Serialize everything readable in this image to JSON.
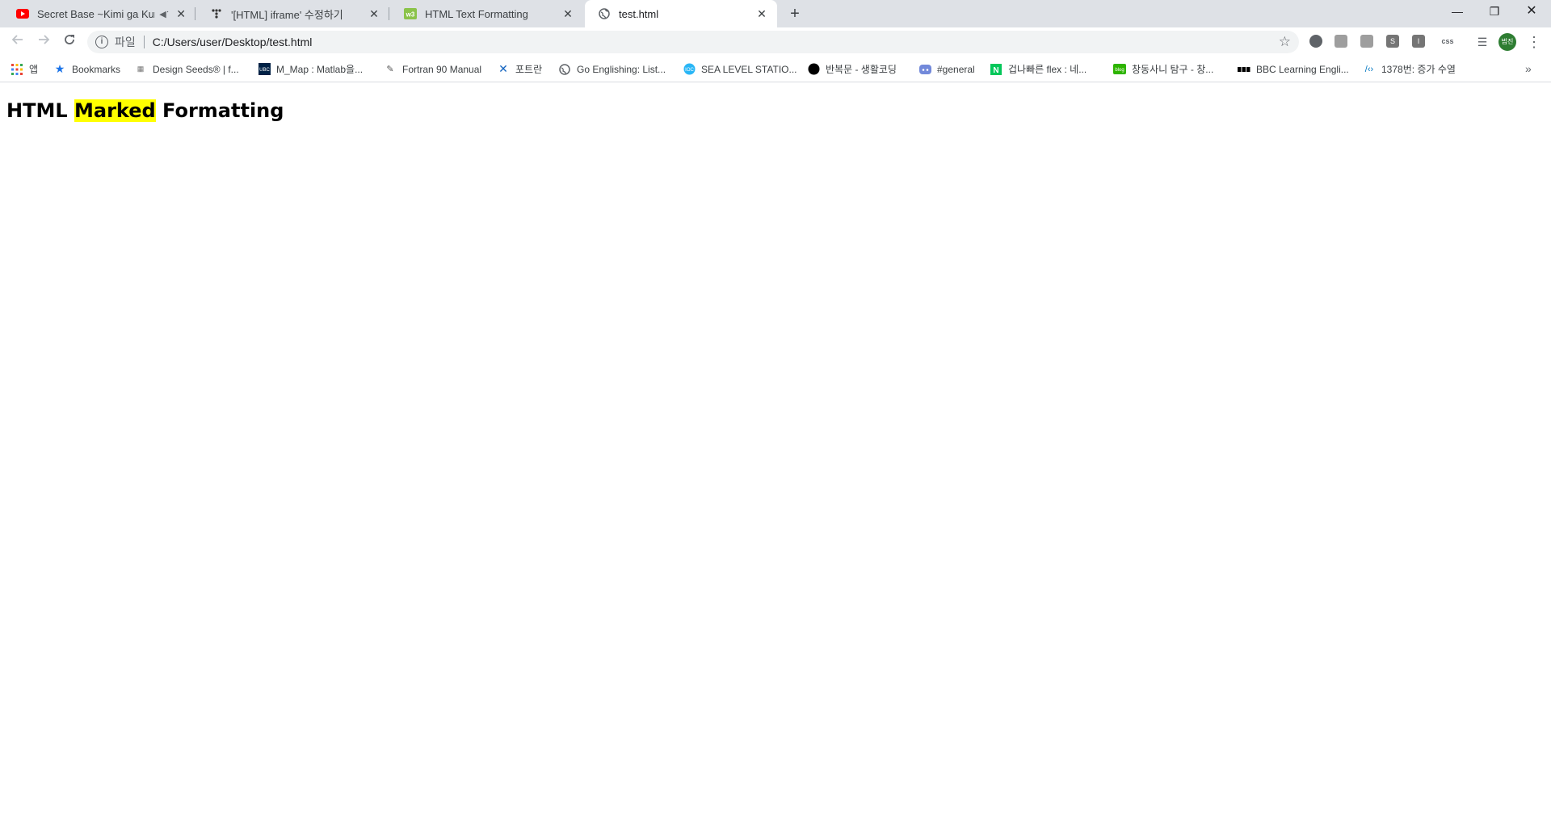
{
  "tabs": [
    {
      "title": "Secret Base ~Kimi ga Kureta",
      "icon": "youtube-icon",
      "muted": true,
      "active": false
    },
    {
      "title": "'[HTML] iframe' 수정하기",
      "icon": "velog-icon",
      "muted": false,
      "active": false
    },
    {
      "title": "HTML Text Formatting",
      "icon": "w3schools-icon",
      "muted": false,
      "active": false
    },
    {
      "title": "test.html",
      "icon": "globe-icon",
      "muted": false,
      "active": true
    }
  ],
  "omnibox": {
    "scheme_label": "파일",
    "url": "C:/Users/user/Desktop/test.html"
  },
  "extensions": [
    "",
    "",
    "",
    "S",
    "I",
    "css"
  ],
  "profile": {
    "initials": "범진"
  },
  "bookmarks": [
    {
      "label": "앱",
      "icon": "apps-grid-icon"
    },
    {
      "label": "Bookmarks",
      "icon": "star-icon"
    },
    {
      "label": "Design Seeds® | f...",
      "icon": "design-seeds-icon"
    },
    {
      "label": "M_Map : Matlab을...",
      "icon": "ubc-icon"
    },
    {
      "label": "Fortran 90 Manual",
      "icon": "fortran-icon"
    },
    {
      "label": "포트란",
      "icon": "fortran-cross-icon"
    },
    {
      "label": "Go Englishing: List...",
      "icon": "globe-icon"
    },
    {
      "label": "SEA LEVEL STATIO...",
      "icon": "sea-level-icon"
    },
    {
      "label": "반복문 - 생활코딩",
      "icon": "black-circle-icon"
    },
    {
      "label": "#general",
      "icon": "discord-icon"
    },
    {
      "label": "겁나빠른 flex : 네...",
      "icon": "naver-icon"
    },
    {
      "label": "창동사니 탐구 - 창...",
      "icon": "blog-icon"
    },
    {
      "label": "BBC Learning Engli...",
      "icon": "bbc-icon"
    },
    {
      "label": "1378번: 증가 수열",
      "icon": "code-brackets-icon"
    }
  ],
  "page": {
    "heading_before": "HTML ",
    "heading_mark": "Marked",
    "heading_after": " Formatting"
  }
}
